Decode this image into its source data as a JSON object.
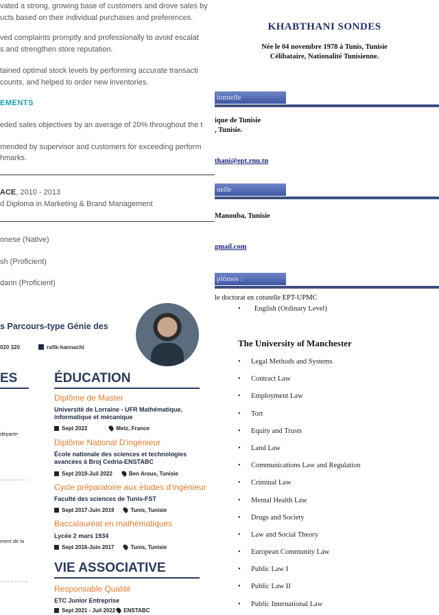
{
  "top_left": {
    "p1": [
      "vated a strong, growing base of customers and drove sales by",
      "ucts based on their individual purchases and preferences."
    ],
    "p2": [
      "ved complaints promptly and professionally to avoid escalat",
      "s and strengthen store reputation."
    ],
    "p3": [
      "tained optimal stock levels by performing accurate transacti",
      " counts, and helped to order new inventories."
    ],
    "achievements_heading": "EMENTS",
    "a1": "eded sales objectives by an average of 20% throughout the t",
    "a2": [
      "mended by supervisor and customers for exceeding perform",
      "hmarks."
    ],
    "edu_school": "ACE",
    "edu_years": ", 2010 - 2013",
    "edu_degree": "d Diploma in Marketing & Brand Management",
    "lang1": "onese (Native)",
    "lang2": "sh (Proficient)",
    "lang3": "darin (Proficient)"
  },
  "top_right": {
    "name": "KHABTHANI SONDES",
    "birth": "Née le 04 novembre 1978 à Tunis, Tunisie",
    "status": "Célibataire, Nationalité Tunisienne.",
    "bar1": "ionnelle",
    "inst1": "ique de Tunisie",
    "inst2": "Tunisie.",
    "email1": "thani@ept.rnu.tn",
    "bar2": "nelle",
    "addr": "Manouba, Tunisie",
    "email2": "gmail.com",
    "bar3": "plômes :",
    "diploma": "le doctorat en cotutelle EPT-UPMC"
  },
  "bottom_left": {
    "profile_title": "s Parcours-type Génie des",
    "phone": "020 320",
    "linkedin": "rafik-hannachi",
    "left_section": "ES",
    "education_title": "ÉDUCATION",
    "left_frag1": "départe-",
    "left_frag2": "ment de la",
    "education": [
      {
        "degree": "Diplôme de Master",
        "inst": [
          "Université de Lorraine - UFR Mathématique,",
          "informatique et mécanique"
        ],
        "date": "Sept 2022",
        "place": "Metz, France"
      },
      {
        "degree": "Diplôme National D'ingénieur",
        "inst": [
          "École nationale des sciences et technologies",
          "avancées à Broj Cedria-ENSTABC"
        ],
        "date": "Sept 2019-Juil 2022",
        "place": "Ben Arous, Tunisie"
      },
      {
        "degree": "Cycle préparatoire aux études d'ingénieur",
        "inst": [
          "Faculté des sciences de Tunis-FST"
        ],
        "date": "Sept 2017-Juin 2019",
        "place": "Tunis, Tunisie"
      },
      {
        "degree": "Baccalauréat en mathématiques",
        "inst": [
          "Lycée 2 mars 1934"
        ],
        "date": "Sept 2016-Juin 2017",
        "place": "Tunis, Tunisie"
      }
    ],
    "assoc_title": "VIE ASSOCIATIVE",
    "assoc_role": "Responsable Qualité",
    "assoc_org": "ETC Junior Entreprise",
    "assoc_date": "Sept 2021 - Juil 2022",
    "assoc_place": "ENSTABC"
  },
  "bottom_right": {
    "first_item": "English (Ordinary Level)",
    "university": "The University of Manchester",
    "courses": [
      "Legal Methods and Systems",
      "Contract Law",
      "Employment Law",
      "Tort",
      "Equity and Trusts",
      "Land Law",
      "Communications Law and Regulation",
      "Criminal Law",
      "Mental Health Law",
      "Drugs and Society",
      "Law and Social Theory",
      "European Community Law",
      "Public Law I",
      "Public Law II",
      "Public International Law"
    ]
  }
}
